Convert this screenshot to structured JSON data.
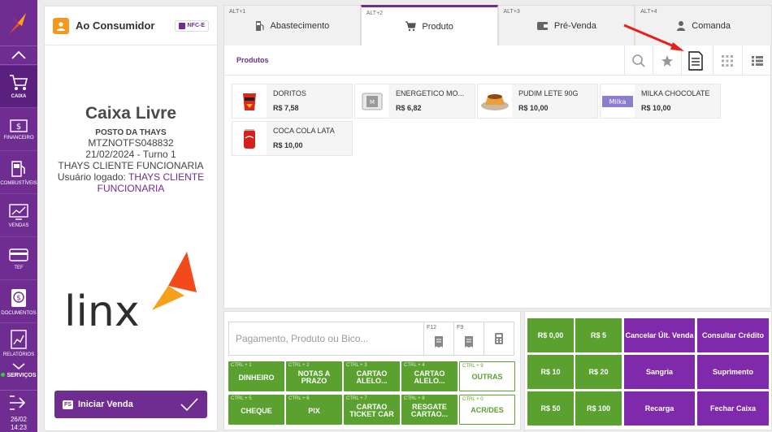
{
  "sidebar": {
    "items": [
      {
        "label": "CAIXA",
        "icon": "cart-icon"
      },
      {
        "label": "FINANCEIRO",
        "icon": "cash-icon"
      },
      {
        "label": "COMBUSTÍVEIS",
        "icon": "fuel-pump-icon"
      },
      {
        "label": "VENDAS",
        "icon": "chart-icon"
      },
      {
        "label": "TEF",
        "icon": "card-icon"
      },
      {
        "label": "DOCUMENTOS",
        "icon": "document-icon"
      },
      {
        "label": "RELATÓRIOS",
        "icon": "report-icon"
      }
    ],
    "services_label": "SERVIÇOS",
    "date": "26/02",
    "time": "14:23"
  },
  "left_panel": {
    "customer": "Ao Consumidor",
    "doc_type": "NFC-E",
    "status_title": "Caixa Livre",
    "station": "POSTO DA THAYS",
    "terminal": "MTZNOTFS048832",
    "date_shift": "21/02/2024 - Turno 1",
    "operator": "THAYS CLIENTE FUNCIONARIA",
    "user_prefix": "Usuário logado:",
    "user_name": "THAYS CLIENTE FUNCIONARIA",
    "logo_text": "linx",
    "start_key": "FS",
    "start_label": "Iniciar Venda"
  },
  "tabs": [
    {
      "key": "ALT+1",
      "label": "Abastecimento",
      "icon": "fuel-pump-icon"
    },
    {
      "key": "ALT+2",
      "label": "Produto",
      "icon": "cart-icon"
    },
    {
      "key": "ALT+3",
      "label": "Pré-Venda",
      "icon": "wallet-icon"
    },
    {
      "key": "ALT+4",
      "label": "Comanda",
      "icon": "user-icon"
    }
  ],
  "products_header": "Produtos",
  "products": [
    {
      "name": "DORITOS",
      "price": "R$ 7,58",
      "img": "doritos"
    },
    {
      "name": "ENERGETICO MO...",
      "price": "R$ 6,82",
      "img": "energy"
    },
    {
      "name": "PUDIM LETE 90G",
      "price": "R$ 10,00",
      "img": "pudim"
    },
    {
      "name": "MILKA CHOCOLATE",
      "price": "R$ 10,00",
      "img": "milka"
    },
    {
      "name": "COCA COLA LATA",
      "price": "R$ 10,00",
      "img": "coke"
    }
  ],
  "payment": {
    "placeholder": "Pagamento, Produto ou Bico...",
    "key_f12": "F12",
    "key_f9": "F9",
    "buttons": [
      {
        "key": "CTRL + 1",
        "label": "DINHEIRO"
      },
      {
        "key": "CTRL + 2",
        "label": "NOTAS A PRAZO"
      },
      {
        "key": "CTRL + 3",
        "label": "CARTAO ALELO..."
      },
      {
        "key": "CTRL + 4",
        "label": "CARTAO ALELO..."
      },
      {
        "key": "CTRL + 9",
        "label": "OUTRAS"
      },
      {
        "key": "CTRL + 5",
        "label": "CHEQUE"
      },
      {
        "key": "CTRL + 6",
        "label": "PIX"
      },
      {
        "key": "CTRL + 7",
        "label": "CARTAO TICKET CAR"
      },
      {
        "key": "CTRL + 8",
        "label": "RESGATE CARTAO..."
      },
      {
        "key": "CTRL + 0",
        "label": "ACR/DES"
      }
    ]
  },
  "quick": {
    "values": [
      "R$ 0,00",
      "R$ 5",
      "R$ 10",
      "R$ 20",
      "R$ 50",
      "R$ 100"
    ],
    "actions": [
      "Cancelar Últ. Venda",
      "Consultar Crédito",
      "Sangria",
      "Suprimento",
      "Recarga",
      "Fechar Caixa"
    ]
  },
  "colors": {
    "brand": "#6f2d91",
    "green": "#5aa130",
    "purple_btn": "#7f2aab",
    "orange": "#f39a1e"
  }
}
